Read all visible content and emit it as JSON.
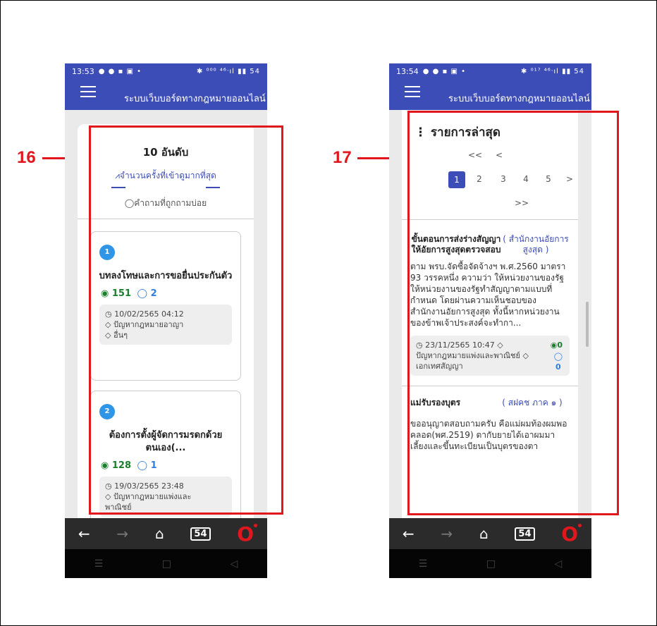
{
  "annotations": {
    "left_label": "16",
    "right_label": "17"
  },
  "status_left": {
    "time": "13:53",
    "icons": "● ● ▪ ▣ •",
    "right": "✱ ⁰⁰⁰ ⁴⁶ᐧıl ▮▮ 54"
  },
  "status_right": {
    "time": "13:54",
    "icons": "● ● ▪ ▣ •",
    "right": "✱ ⁰¹⁷ ⁴⁶ᐧıl ▮▮ 54"
  },
  "app": {
    "title": "ระบบเว็บบอร์ดทางกฎหมายออนไลน์"
  },
  "left_screen": {
    "heading": "10 อันดับ",
    "tab_views": "⩘จำนวนครั้งที่เข้าดูมากที่สุด",
    "tab_faq": "◯คำถามที่ถูกถามบ่อย",
    "items": [
      {
        "rank": "1",
        "title": "บทลงโทษและการขอยื่นประกันตัว",
        "views": "151",
        "comments": "2",
        "date": "10/02/2565 04:12",
        "tag1": "ปัญหากฎหมายอาญา",
        "tag2": "อื่นๆ"
      },
      {
        "rank": "2",
        "title": "ต้องการตั้งผู้จัดการมรดกด้วยตนเอง(...",
        "views": "128",
        "comments": "1",
        "date": "19/03/2565 23:48",
        "tag1": "ปัญหากฎหมายแพ่งและ",
        "tag2": "พาณิชย์"
      }
    ]
  },
  "right_screen": {
    "heading": "รายการล่าสุด",
    "pager": {
      "first": "<<",
      "prev": "<",
      "pages": [
        "1",
        "2",
        "3",
        "4",
        "5"
      ],
      "next": ">",
      "last": ">>"
    },
    "items": [
      {
        "title": "ขั้นตอนการส่งร่างสัญญาให้อัยการสูงสุดตรวจสอบ",
        "category": "( สำนักงานอัยการสูงสุด )",
        "excerpt": "ตาม พรบ.จัดซื้อจัดจ้างฯ พ.ศ.2560 มาตรา 93 วรรคหนึ่ง ความว่า ให้หน่วยงานของรัฐให้หน่วยงานของรัฐทำสัญญาตามแบบที่กำหนด โดยผ่านความเห็นชอบของสำนักงานอัยการสูงสุด ทั้งนี้หากหน่วยงานของข้าพเจ้าประสงค์จะทำกา...",
        "date": "23/11/2565 10:47",
        "tags": "ปัญหากฎหมายแพ่งและพาณิชย์ ◇ เอกเทศสัญญา",
        "views": "0",
        "comments": "0"
      },
      {
        "title": "แม่รับรองบุตร",
        "category": "( สฝคช ภาค ๑ )",
        "excerpt": "ขออนุญาตสอบถามครับ คือแม่ผมท้องผมพอคลอด(พศ.2519) ตากับยายได้เอาผมมาเลี้ยงและขึ้นทะเบียนเป็นบุตรของตา"
      }
    ]
  },
  "navbar": {
    "back": "←",
    "forward": "→",
    "home": "⌂",
    "tabs": "54",
    "opera": "O"
  },
  "sysbar": {
    "recent": "☰",
    "home": "□",
    "back": "◁"
  },
  "colors": {
    "appbar": "#3d4db7",
    "highlight": "#e0171c",
    "views": "#1a7f2c",
    "comments": "#2f7fe0"
  }
}
